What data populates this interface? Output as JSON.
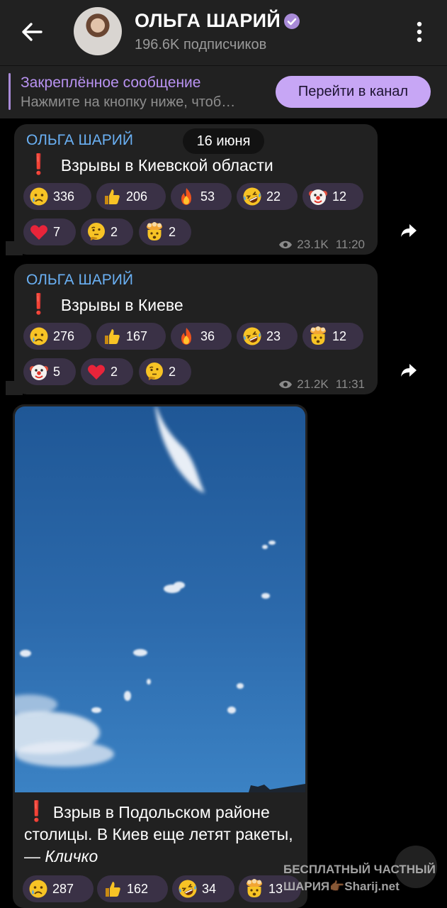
{
  "header": {
    "title": "ОЛЬГА ШАРИЙ",
    "subscribers": "196.6K подписчиков"
  },
  "pinned": {
    "title": "Закреплённое сообщение",
    "preview": "Нажмите на кнопку ниже, чтоб…",
    "button": "Перейти в канал"
  },
  "date_chip": "16 июня",
  "messages": [
    {
      "sender": "ОЛЬГА ШАРИЙ",
      "text": "Взрывы в Киевской области",
      "reactions": [
        {
          "emoji": "crying-face",
          "count": "336"
        },
        {
          "emoji": "thumbs-up",
          "count": "206"
        },
        {
          "emoji": "fire",
          "count": "53"
        },
        {
          "emoji": "rofl-face",
          "count": "22"
        },
        {
          "emoji": "clown-face",
          "count": "12"
        },
        {
          "emoji": "red-heart",
          "count": "7"
        },
        {
          "emoji": "thinking-face",
          "count": "2"
        },
        {
          "emoji": "exploding-head",
          "count": "2"
        }
      ],
      "views": "23.1K",
      "time": "11:20"
    },
    {
      "sender": "ОЛЬГА ШАРИЙ",
      "text": "Взрывы в Киеве",
      "reactions": [
        {
          "emoji": "crying-face",
          "count": "276"
        },
        {
          "emoji": "thumbs-up",
          "count": "167"
        },
        {
          "emoji": "fire",
          "count": "36"
        },
        {
          "emoji": "rofl-face",
          "count": "23"
        },
        {
          "emoji": "exploding-head",
          "count": "12"
        },
        {
          "emoji": "clown-face",
          "count": "5"
        },
        {
          "emoji": "red-heart",
          "count": "2"
        },
        {
          "emoji": "thinking-face",
          "count": "2"
        }
      ],
      "views": "21.2K",
      "time": "11:31"
    },
    {
      "caption_main": "Взрыв в Подольском районе столицы. В Киев еще летят ракеты, — ",
      "caption_italic": "Кличко",
      "reactions": [
        {
          "emoji": "crying-face",
          "count": "287"
        },
        {
          "emoji": "thumbs-up",
          "count": "162"
        },
        {
          "emoji": "rofl-face",
          "count": "34"
        },
        {
          "emoji": "exploding-head",
          "count": "13"
        }
      ]
    }
  ],
  "watermark": {
    "line1": "БЕСПЛАТНЫЙ ЧАСТНЫЙ",
    "line2": "ШАРИЯ👉🏾Sharij.net"
  },
  "colors": {
    "background": "#000000",
    "bar": "#212121",
    "bubble": "#212121",
    "accent": "#c7a6f5",
    "sender": "#6ab0f3",
    "reaction_bg": "#3a3146"
  }
}
